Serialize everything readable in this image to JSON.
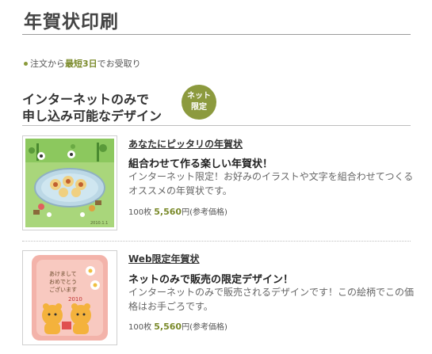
{
  "page": {
    "title": "年賀状印刷"
  },
  "order_note": {
    "prefix": "注文から",
    "highlight": "最短3日",
    "suffix": "でお受取り"
  },
  "section": {
    "heading_line1": "インターネットのみで",
    "heading_line2": "申し込み可能なデザイン",
    "badge_line1": "ネット",
    "badge_line2": "限定"
  },
  "products": [
    {
      "link": "あなたにピッタリの年賀状",
      "headline": "組合わせて作る楽しい年賀状！",
      "description": "インターネット限定！お好みのイラストや文字を組合わせてつくるオススメの年賀状です。",
      "price_count": "100枚",
      "price_amount": "5,560",
      "price_unit": "円(参考価格)",
      "thumb_caption": "2010.1.1"
    },
    {
      "link": "Web限定年賀状",
      "headline": "ネットのみで販売の限定デザイン！",
      "description": "インターネットのみで販売されるデザインです！この絵柄でこの価格はお手ごろです。",
      "price_count": "100枚",
      "price_amount": "5,560",
      "price_unit": "円(参考価格)",
      "thumb_text_line1": "あけまして",
      "thumb_text_line2": "おめでとう",
      "thumb_text_line3": "ございます",
      "thumb_year": "2010"
    }
  ],
  "colors": {
    "accent_green": "#7a8a2a",
    "badge_green": "#8c9a3e"
  }
}
